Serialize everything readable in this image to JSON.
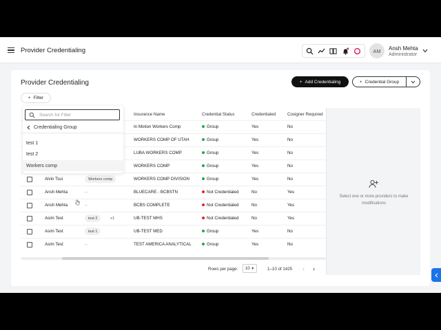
{
  "header": {
    "app_title": "Provider Credentialing",
    "icons": [
      "search-icon",
      "trend-icon",
      "book-icon",
      "bell-icon",
      "status-ring-icon"
    ],
    "user": {
      "initials": "AM",
      "name": "Ansh Mehta",
      "role": "Administrator"
    }
  },
  "page": {
    "title": "Provider Credentialing",
    "add_button": "Add Credentialing",
    "group_button": "Credential Group",
    "filter_button": "Filter"
  },
  "filter_popup": {
    "search_placeholder": "Search for Filter",
    "back_label": "Credentialing Group",
    "options": [
      "test 1",
      "test 2",
      "Workers comp"
    ],
    "hovered": "Workers comp"
  },
  "table": {
    "columns": {
      "insurance": "Insurance Name",
      "status": "Credential Status",
      "credentialed": "Credentialed",
      "cosigner": "Cosigner Required"
    },
    "rows": [
      {
        "provider": "",
        "groups": [],
        "insurance": "In Motion Workers Comp",
        "status": "Group",
        "credentialed": "Yes",
        "cosigner": "No"
      },
      {
        "provider": "",
        "groups": [],
        "insurance": "WORKERS COMP OF UTAH",
        "status": "Group",
        "credentialed": "Yes",
        "cosigner": "No"
      },
      {
        "provider": "",
        "groups": [],
        "insurance": "LUBA WORKERS COMP",
        "status": "Group",
        "credentialed": "Yes",
        "cosigner": "No"
      },
      {
        "provider": "",
        "groups": [],
        "insurance": "WORKERS COMP",
        "status": "Group",
        "credentialed": "Yes",
        "cosigner": "No"
      },
      {
        "provider": "Alvin Tsui",
        "groups": [
          "Workers comp"
        ],
        "insurance": "WORKERS COMP DIVISION",
        "status": "Group",
        "credentialed": "Yes",
        "cosigner": "No"
      },
      {
        "provider": "Ansh Mehta",
        "groups": [],
        "empty": "--",
        "insurance": "BLUECARE - BCBSTN",
        "status": "Not Credentialed",
        "credentialed": "No",
        "cosigner": "Yes"
      },
      {
        "provider": "Ansh Mehta",
        "groups": [],
        "empty": "--",
        "insurance": "BCBS COMPLETE",
        "status": "Not Credentialed",
        "credentialed": "No",
        "cosigner": "Yes"
      },
      {
        "provider": "Asim Test",
        "groups": [
          "test 2",
          "+1"
        ],
        "insurance": "UB-TEST MHS",
        "status": "Not Credentialed",
        "credentialed": "No",
        "cosigner": "Yes"
      },
      {
        "provider": "Asim Test",
        "groups": [
          "test 1"
        ],
        "insurance": "UB-TEST MED",
        "status": "Group",
        "credentialed": "Yes",
        "cosigner": "No"
      },
      {
        "provider": "Asim Test",
        "groups": [],
        "empty": "--",
        "insurance": "TEST AMERICA ANALYTICAL",
        "status": "Group",
        "credentialed": "Yes",
        "cosigner": "No"
      }
    ]
  },
  "pagination": {
    "rows_label": "Rows per page:",
    "rows_value": "10",
    "range": "1–10 of 1425"
  },
  "side_panel": {
    "message": "Select one or more providers to make modifications"
  },
  "colors": {
    "group": "#1fa84f",
    "not_credentialed": "#e02424",
    "primary": "#111111",
    "accent_tab": "#1a73e8"
  }
}
